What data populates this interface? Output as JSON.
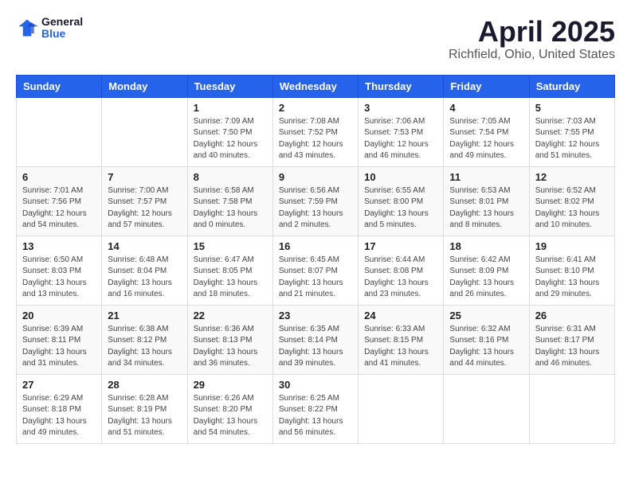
{
  "logo": {
    "general": "General",
    "blue": "Blue"
  },
  "title": "April 2025",
  "location": "Richfield, Ohio, United States",
  "days_of_week": [
    "Sunday",
    "Monday",
    "Tuesday",
    "Wednesday",
    "Thursday",
    "Friday",
    "Saturday"
  ],
  "weeks": [
    [
      {
        "day": "",
        "info": ""
      },
      {
        "day": "",
        "info": ""
      },
      {
        "day": "1",
        "info": "Sunrise: 7:09 AM\nSunset: 7:50 PM\nDaylight: 12 hours and 40 minutes."
      },
      {
        "day": "2",
        "info": "Sunrise: 7:08 AM\nSunset: 7:52 PM\nDaylight: 12 hours and 43 minutes."
      },
      {
        "day": "3",
        "info": "Sunrise: 7:06 AM\nSunset: 7:53 PM\nDaylight: 12 hours and 46 minutes."
      },
      {
        "day": "4",
        "info": "Sunrise: 7:05 AM\nSunset: 7:54 PM\nDaylight: 12 hours and 49 minutes."
      },
      {
        "day": "5",
        "info": "Sunrise: 7:03 AM\nSunset: 7:55 PM\nDaylight: 12 hours and 51 minutes."
      }
    ],
    [
      {
        "day": "6",
        "info": "Sunrise: 7:01 AM\nSunset: 7:56 PM\nDaylight: 12 hours and 54 minutes."
      },
      {
        "day": "7",
        "info": "Sunrise: 7:00 AM\nSunset: 7:57 PM\nDaylight: 12 hours and 57 minutes."
      },
      {
        "day": "8",
        "info": "Sunrise: 6:58 AM\nSunset: 7:58 PM\nDaylight: 13 hours and 0 minutes."
      },
      {
        "day": "9",
        "info": "Sunrise: 6:56 AM\nSunset: 7:59 PM\nDaylight: 13 hours and 2 minutes."
      },
      {
        "day": "10",
        "info": "Sunrise: 6:55 AM\nSunset: 8:00 PM\nDaylight: 13 hours and 5 minutes."
      },
      {
        "day": "11",
        "info": "Sunrise: 6:53 AM\nSunset: 8:01 PM\nDaylight: 13 hours and 8 minutes."
      },
      {
        "day": "12",
        "info": "Sunrise: 6:52 AM\nSunset: 8:02 PM\nDaylight: 13 hours and 10 minutes."
      }
    ],
    [
      {
        "day": "13",
        "info": "Sunrise: 6:50 AM\nSunset: 8:03 PM\nDaylight: 13 hours and 13 minutes."
      },
      {
        "day": "14",
        "info": "Sunrise: 6:48 AM\nSunset: 8:04 PM\nDaylight: 13 hours and 16 minutes."
      },
      {
        "day": "15",
        "info": "Sunrise: 6:47 AM\nSunset: 8:05 PM\nDaylight: 13 hours and 18 minutes."
      },
      {
        "day": "16",
        "info": "Sunrise: 6:45 AM\nSunset: 8:07 PM\nDaylight: 13 hours and 21 minutes."
      },
      {
        "day": "17",
        "info": "Sunrise: 6:44 AM\nSunset: 8:08 PM\nDaylight: 13 hours and 23 minutes."
      },
      {
        "day": "18",
        "info": "Sunrise: 6:42 AM\nSunset: 8:09 PM\nDaylight: 13 hours and 26 minutes."
      },
      {
        "day": "19",
        "info": "Sunrise: 6:41 AM\nSunset: 8:10 PM\nDaylight: 13 hours and 29 minutes."
      }
    ],
    [
      {
        "day": "20",
        "info": "Sunrise: 6:39 AM\nSunset: 8:11 PM\nDaylight: 13 hours and 31 minutes."
      },
      {
        "day": "21",
        "info": "Sunrise: 6:38 AM\nSunset: 8:12 PM\nDaylight: 13 hours and 34 minutes."
      },
      {
        "day": "22",
        "info": "Sunrise: 6:36 AM\nSunset: 8:13 PM\nDaylight: 13 hours and 36 minutes."
      },
      {
        "day": "23",
        "info": "Sunrise: 6:35 AM\nSunset: 8:14 PM\nDaylight: 13 hours and 39 minutes."
      },
      {
        "day": "24",
        "info": "Sunrise: 6:33 AM\nSunset: 8:15 PM\nDaylight: 13 hours and 41 minutes."
      },
      {
        "day": "25",
        "info": "Sunrise: 6:32 AM\nSunset: 8:16 PM\nDaylight: 13 hours and 44 minutes."
      },
      {
        "day": "26",
        "info": "Sunrise: 6:31 AM\nSunset: 8:17 PM\nDaylight: 13 hours and 46 minutes."
      }
    ],
    [
      {
        "day": "27",
        "info": "Sunrise: 6:29 AM\nSunset: 8:18 PM\nDaylight: 13 hours and 49 minutes."
      },
      {
        "day": "28",
        "info": "Sunrise: 6:28 AM\nSunset: 8:19 PM\nDaylight: 13 hours and 51 minutes."
      },
      {
        "day": "29",
        "info": "Sunrise: 6:26 AM\nSunset: 8:20 PM\nDaylight: 13 hours and 54 minutes."
      },
      {
        "day": "30",
        "info": "Sunrise: 6:25 AM\nSunset: 8:22 PM\nDaylight: 13 hours and 56 minutes."
      },
      {
        "day": "",
        "info": ""
      },
      {
        "day": "",
        "info": ""
      },
      {
        "day": "",
        "info": ""
      }
    ]
  ]
}
